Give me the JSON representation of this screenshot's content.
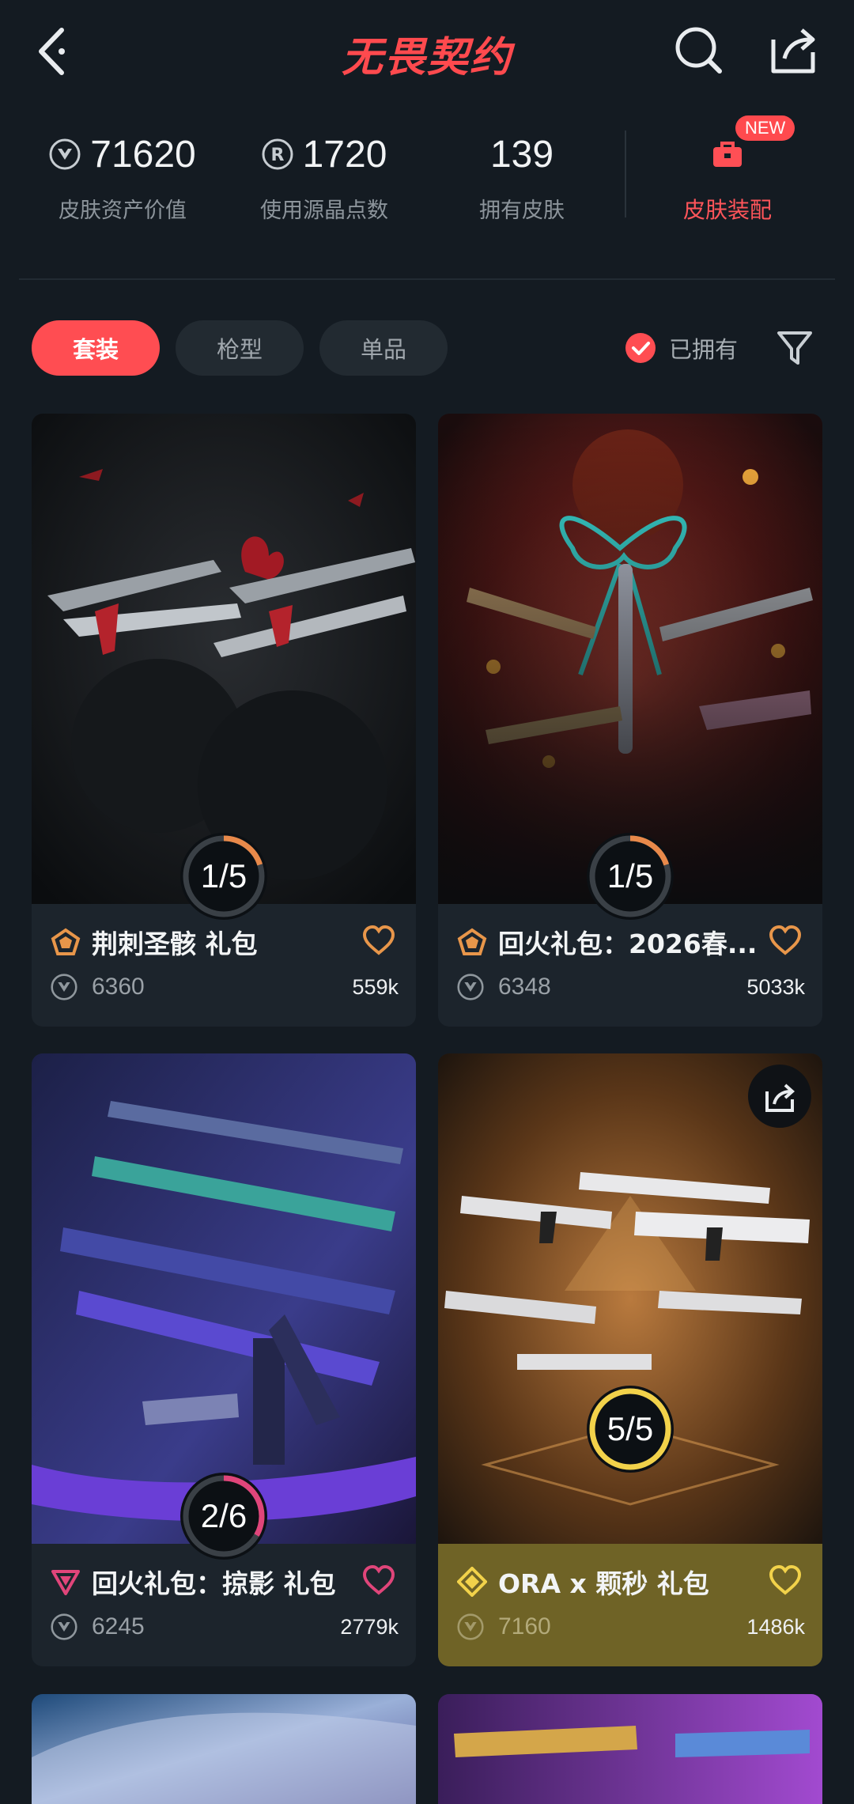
{
  "header": {
    "title": "无畏契约",
    "icons": [
      "back-icon",
      "search-icon",
      "share-icon"
    ]
  },
  "stats": {
    "asset_value": "71620",
    "asset_value_label": "皮肤资产价值",
    "radianite_points": "1720",
    "radianite_label": "使用源晶点数",
    "owned_skins": "139",
    "owned_skins_label": "拥有皮肤",
    "equip_label": "皮肤装配",
    "new_badge": "NEW"
  },
  "filters": {
    "tabs": [
      "套装",
      "枪型",
      "单品"
    ],
    "owned_label": "已拥有"
  },
  "cards": [
    {
      "title": "荆刺圣骸 礼包",
      "progress": "1/5",
      "owned": 1,
      "total": 5,
      "price": "6360",
      "likes": "559k",
      "tier_color": "#e8964a",
      "ring_color": "#e8894a"
    },
    {
      "title": "回火礼包：2026春...",
      "progress": "1/5",
      "owned": 1,
      "total": 5,
      "price": "6348",
      "likes": "5033k",
      "tier_color": "#e8964a",
      "ring_color": "#e8894a"
    },
    {
      "title": "回火礼包：掠影 礼包",
      "progress": "2/6",
      "owned": 2,
      "total": 6,
      "price": "6245",
      "likes": "2779k",
      "tier_color": "#e0457a",
      "ring_color": "#e0457a"
    },
    {
      "title": "ORA x 颗秒 礼包",
      "progress": "5/5",
      "owned": 5,
      "total": 5,
      "price": "7160",
      "likes": "1486k",
      "tier_color": "#f2d24a",
      "ring_color": "#f2d24a"
    }
  ],
  "colors": {
    "accent": "#ff4d52",
    "background": "#141b22"
  }
}
